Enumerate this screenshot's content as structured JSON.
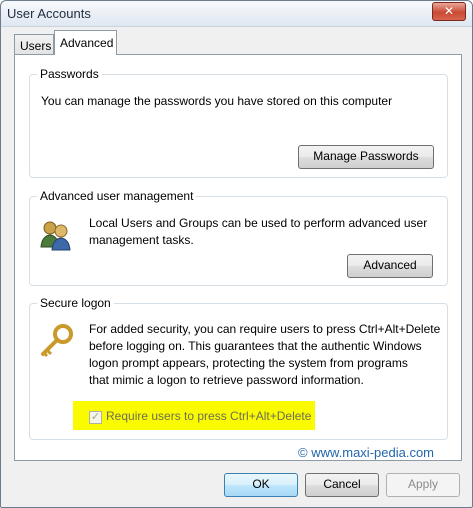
{
  "window": {
    "title": "User Accounts",
    "close_label": "✕"
  },
  "tabs": [
    {
      "label": "Users"
    },
    {
      "label": "Advanced"
    }
  ],
  "passwords": {
    "title": "Passwords",
    "text": "You can manage the passwords you have stored on this computer",
    "button": "Manage Passwords"
  },
  "advanced_mgmt": {
    "title": "Advanced user management",
    "text_line1": "Local Users and Groups can be used to perform advanced user",
    "text_line2": "management tasks.",
    "button": "Advanced",
    "icon": "users-icon"
  },
  "secure_logon": {
    "title": "Secure logon",
    "text_lines": [
      "For added security, you can require users to press Ctrl+Alt+Delete",
      "before logging on. This guarantees that the authentic Windows",
      "logon prompt appears, protecting the system from programs",
      "that mimic a logon to retrieve password information."
    ],
    "checkbox_label": "Require users to press Ctrl+Alt+Delete",
    "checkbox_checked": true,
    "checkbox_glyph": "✓",
    "icon": "key-icon"
  },
  "watermark": "© www.maxi-pedia.com",
  "footer": {
    "ok": "OK",
    "cancel": "Cancel",
    "apply": "Apply"
  },
  "colors": {
    "highlight": "#fbfb00",
    "watermark": "#2266aa"
  }
}
